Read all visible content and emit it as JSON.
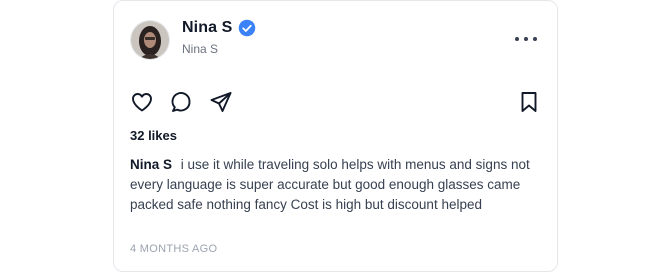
{
  "post": {
    "author": {
      "display_name": "Nina S",
      "handle": "Nina S",
      "verified": true,
      "verified_color": "#3b82f6"
    },
    "icons": {
      "avatar": "profile-photo",
      "more": "more-horizontal-icon",
      "like": "heart-icon",
      "comment": "comment-icon",
      "share": "send-icon",
      "save": "bookmark-icon"
    },
    "likes": "32 likes",
    "caption": {
      "author": "Nina S",
      "text": "i use it while traveling solo helps with menus and signs not every language is super accurate but good enough glasses came packed safe nothing fancy Cost is high but discount helped"
    },
    "timestamp": "4 MONTHS AGO"
  }
}
